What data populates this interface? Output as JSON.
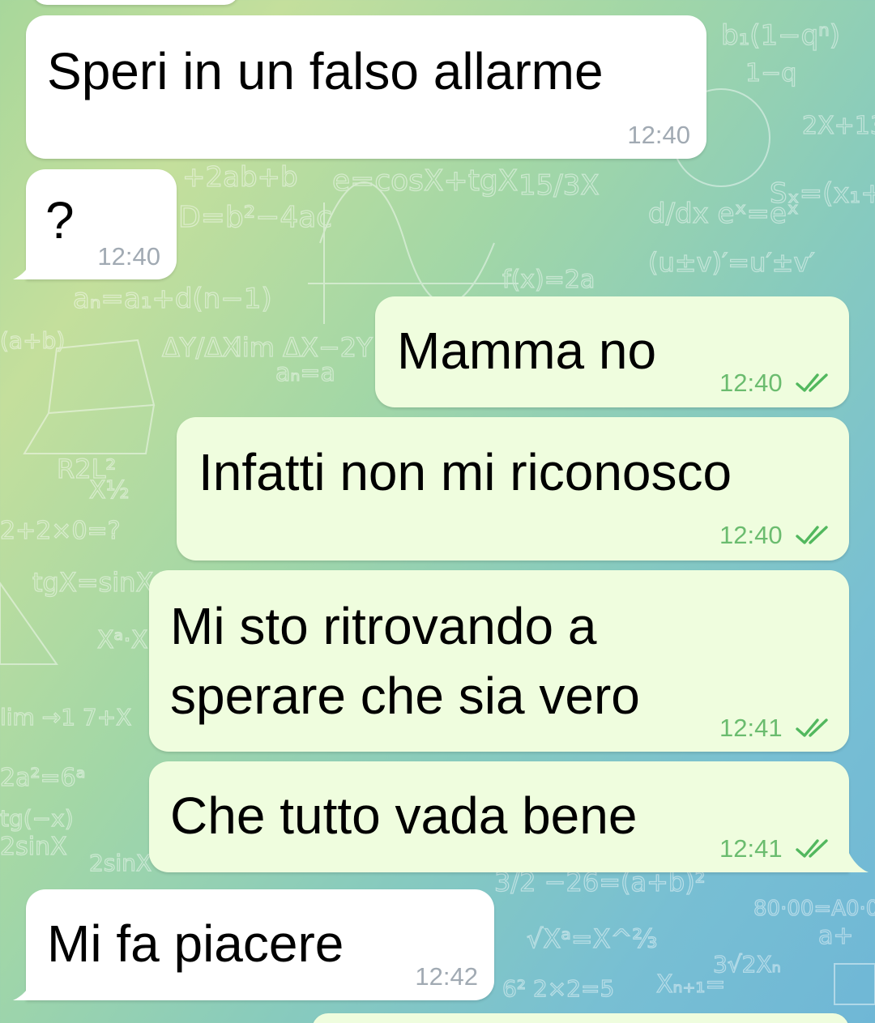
{
  "chat": {
    "messages": [
      {
        "text": "Speri in un falso allarme",
        "time": "12:40",
        "direction": "in",
        "status": ""
      },
      {
        "text": "?",
        "time": "12:40",
        "direction": "in",
        "status": ""
      },
      {
        "text": "Mamma no",
        "time": "12:40",
        "direction": "out",
        "status": "read"
      },
      {
        "text": "Infatti non mi riconosco",
        "time": "12:40",
        "direction": "out",
        "status": "read"
      },
      {
        "text_lines": [
          "Mi sto ritrovando a",
          "sperare che sia vero"
        ],
        "time": "12:41",
        "direction": "out",
        "status": "read"
      },
      {
        "text": "Che tutto vada bene",
        "time": "12:41",
        "direction": "out",
        "status": "read"
      },
      {
        "text": "Mi fa piacere",
        "time": "12:42",
        "direction": "in",
        "status": ""
      }
    ]
  },
  "colors": {
    "incoming_bubble": "#ffffff",
    "outgoing_bubble": "#effdde",
    "read_check": "#52b85e",
    "incoming_time": "#a1aab3",
    "outgoing_time": "#6bbc6f"
  },
  "icons": {
    "read_receipt": "double-check-icon"
  }
}
